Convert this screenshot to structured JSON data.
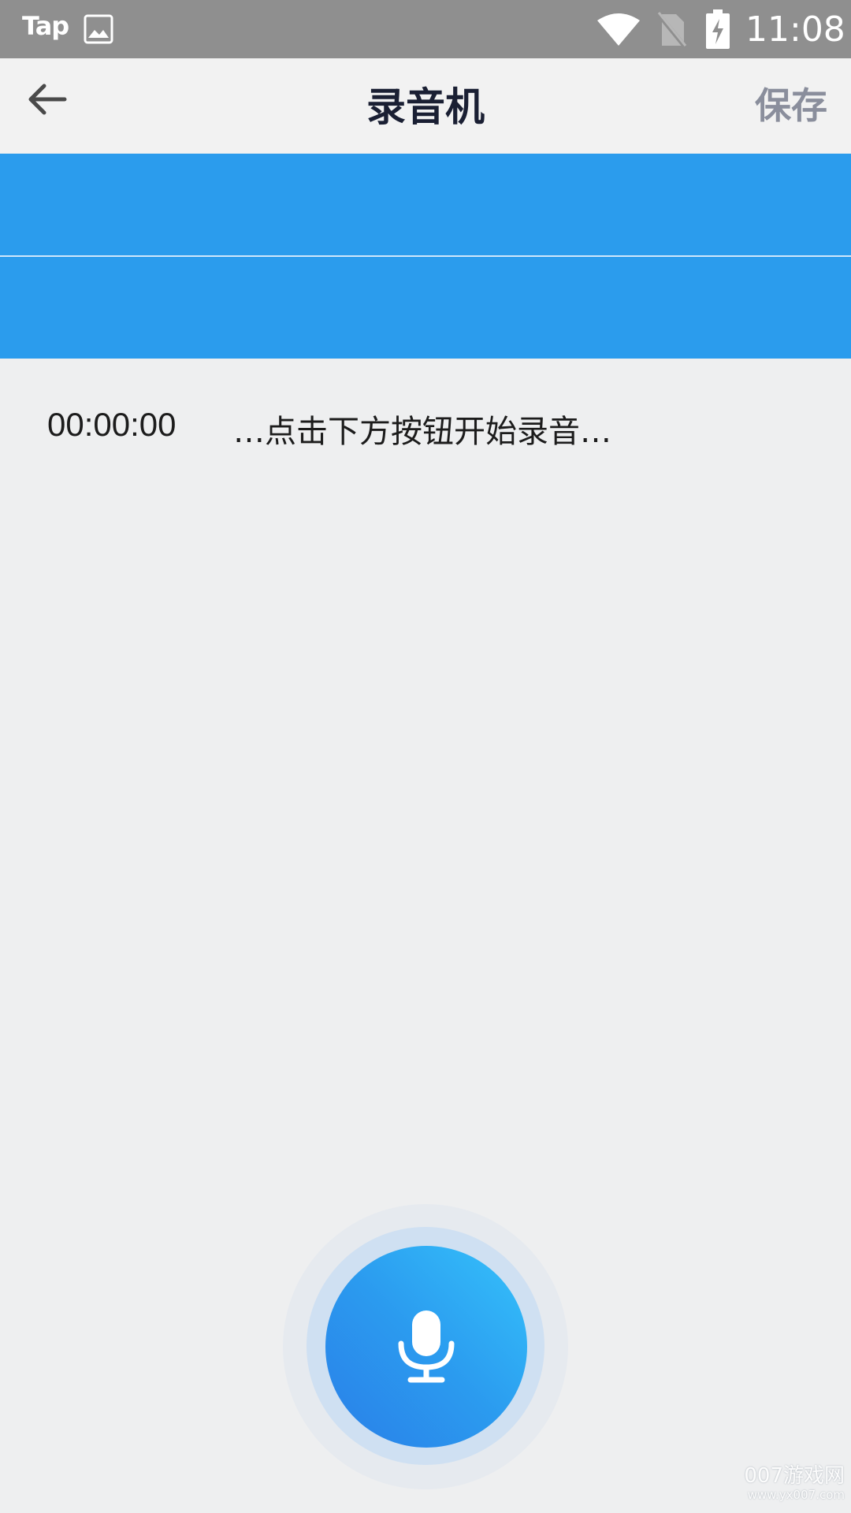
{
  "status_bar": {
    "carrier_label": "Tap",
    "time": "11:08",
    "icons": [
      "gallery-icon",
      "wifi-icon",
      "no-sim-icon",
      "battery-charging-icon"
    ]
  },
  "app_bar": {
    "back_icon": "arrow-left-icon",
    "title": "录音机",
    "save_label": "保存"
  },
  "waveform": {
    "color": "#2b9ced"
  },
  "recording": {
    "elapsed": "00:00:00",
    "hint": "…点击下方按钮开始录音…"
  },
  "record_button": {
    "icon": "microphone-icon"
  },
  "watermark": {
    "main": "007游戏网",
    "url": "www.yx007.com"
  },
  "colors": {
    "status_bar": "#8f8f8f",
    "background": "#eeeff0",
    "accent": "#2b9ced",
    "title": "#1a1f33",
    "save": "#8a8e9c"
  }
}
